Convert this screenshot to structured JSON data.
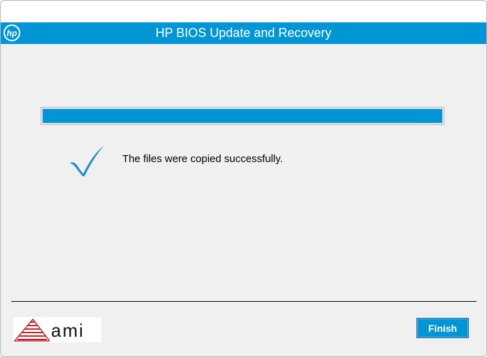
{
  "window": {
    "title": "HP BIOS Update and Recovery"
  },
  "branding": {
    "top_logo_icon": "hp-logo-icon",
    "bottom_logo": "ami",
    "bottom_logo_icon": "ami-logo-icon"
  },
  "progress": {
    "fraction": 1.0
  },
  "status": {
    "icon": "checkmark-icon",
    "message": "The files were copied successfully."
  },
  "footer": {
    "finish_label": "Finish"
  },
  "colors": {
    "accent": "#0096d6",
    "background": "#f0f0f0",
    "text": "#000000",
    "ami_red": "#c1272d"
  }
}
